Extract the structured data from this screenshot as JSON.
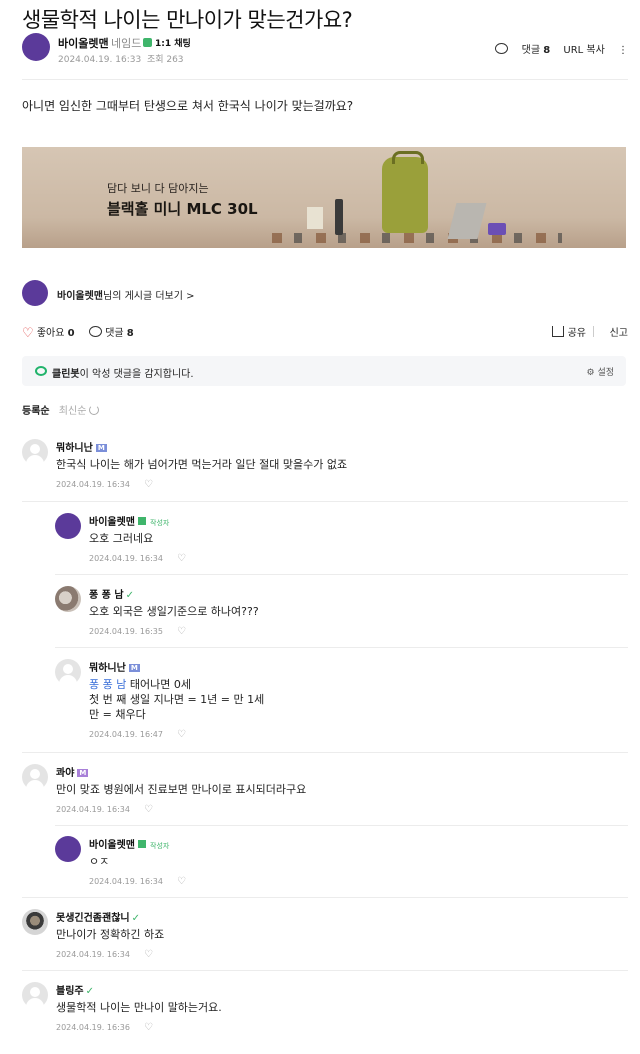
{
  "post": {
    "title": "생물학적 나이는 만나이가 맞는건가요?",
    "author": "바이올렛맨",
    "level": "네임드",
    "chat_label": "1:1 채팅",
    "date": "2024.04.19. 16:33",
    "views": "조회 263",
    "comment_label": "댓글",
    "comment_count": "8",
    "url_copy": "URL 복사",
    "more_icon": "⋮",
    "body": "아니면 임신한 그때부터 탄생으로 쳐서 한국식 나이가 맞는걸까요?"
  },
  "banner": {
    "line1": "담다 보니 다 담아지는",
    "line2": "블랙홀 미니 MLC 30L"
  },
  "more_posts": {
    "author": "바이올렛맨",
    "suffix": "님의 게시글 더보기 >"
  },
  "reactions": {
    "like_label": "좋아요",
    "like_count": "0",
    "comment_label": "댓글",
    "comment_count": "8",
    "share": "공유",
    "report": "신고"
  },
  "cleanbot": {
    "name": "클린봇",
    "message": "이 악성 댓글을 감지합니다.",
    "settings": "설정"
  },
  "sort": {
    "active": "등록순",
    "inactive": "최신순"
  },
  "comments": [
    {
      "nick": "뭐하니난",
      "text": "한국식 나이는 해가 넘어가면 먹는거라 일단 절대 맞을수가 없죠",
      "date": "2024.04.19. 16:34"
    },
    {
      "nick": "바이올렛맨",
      "op": "작성자",
      "text": "오호 그러네요",
      "date": "2024.04.19. 16:34"
    },
    {
      "nick": "퐁 퐁 남",
      "text": "오호 외국은 생일기준으로 하나여???",
      "date": "2024.04.19. 16:35"
    },
    {
      "nick": "뭐하니난",
      "mention": "퐁 퐁 남",
      "line1": "태어나면 0세",
      "line2": "첫 번 째 생일 지나면 = 1년 = 만 1세",
      "line3": "만 = 채우다",
      "date": "2024.04.19. 16:47"
    },
    {
      "nick": "콰야",
      "text": "만이 맞죠 병원에서 진료보면 만나이로 표시되더라구요",
      "date": "2024.04.19. 16:34"
    },
    {
      "nick": "바이올렛맨",
      "op": "작성자",
      "text": "ㅇㅈ",
      "date": "2024.04.19. 16:34"
    },
    {
      "nick": "못생긴건좀괜찮니",
      "text": "만나이가 정확하긴 하죠",
      "date": "2024.04.19. 16:34"
    },
    {
      "nick": "블링주",
      "text": "생물학적 나이는 만나이 말하는거요.",
      "date": "2024.04.19. 16:36"
    }
  ]
}
